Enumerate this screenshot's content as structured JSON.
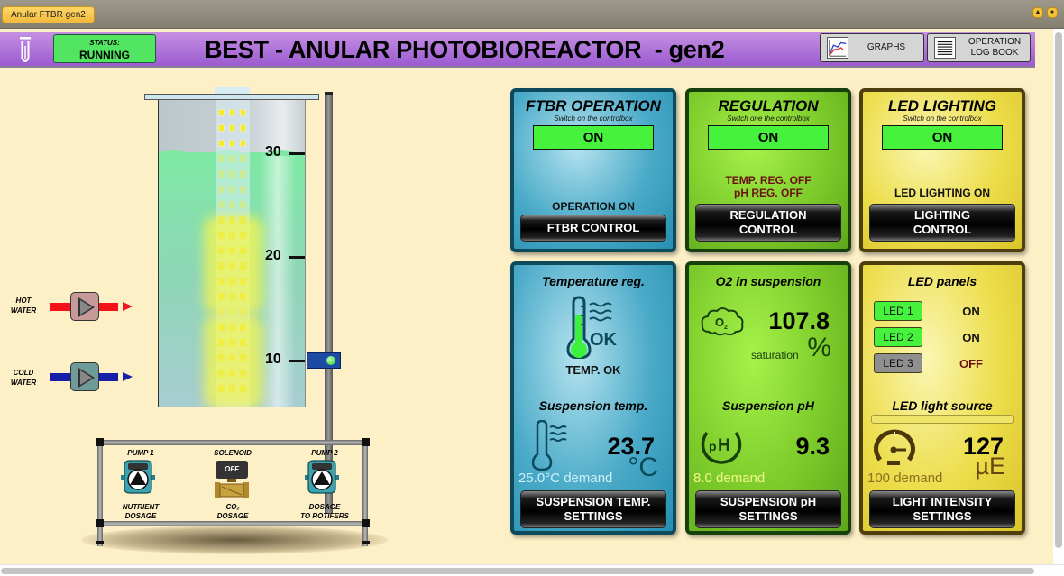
{
  "window": {
    "tab_title": "Anular FTBR gen2",
    "controls": [
      {
        "name": "minimize",
        "glyph": "▲"
      },
      {
        "name": "options",
        "glyph": "●"
      }
    ]
  },
  "header": {
    "logo_icon": "test-tube-icon",
    "status_label": "STATUS:",
    "status_value": "RUNNING",
    "title": "BEST - ANULAR PHOTOBIOREACTOR  - gen2",
    "buttons": [
      {
        "label": "GRAPHS",
        "icon": "graph-icon"
      },
      {
        "label": "OPERATION LOG BOOK",
        "icon": "log-book-icon"
      }
    ]
  },
  "reactor": {
    "scale_labels": [
      "30",
      "20",
      "10"
    ],
    "hot_water_label": "HOT WATER",
    "cold_water_label": "COLD WATER",
    "devices": {
      "pump1_title": "PUMP 1",
      "pump1_caption": "NUTRIENT DOSAGE",
      "solenoid_title": "SOLENOID",
      "solenoid_state": "OFF",
      "solenoid_caption_line1": "CO₂",
      "solenoid_caption_line2": "DOSAGE",
      "pump2_title": "PUMP 2",
      "pump2_caption_line1": "DOSAGE",
      "pump2_caption_line2": "TO ROTIFERS"
    },
    "level_sensor_active": true
  },
  "panels": {
    "ftbr": {
      "title": "FTBR OPERATION",
      "subtitle": "Switch on the controlbox",
      "switch_state": "ON",
      "status": "OPERATION ON",
      "button": "FTBR CONTROL",
      "color": "#4aaac8"
    },
    "regulation": {
      "title": "REGULATION",
      "subtitle": "Switch one the controlbox",
      "switch_state": "ON",
      "status_line1": "TEMP. REG. OFF",
      "status_line2": "pH REG. OFF",
      "button_line1": "REGULATION",
      "button_line2": "CONTROL",
      "color": "#7ccb2a"
    },
    "lighting": {
      "title": "LED LIGHTING",
      "subtitle": "Switch on the controlbox",
      "switch_state": "ON",
      "status": "LED LIGHTING ON",
      "button_line1": "LIGHTING",
      "button_line2": "CONTROL",
      "color": "#ecdd4a"
    },
    "temperature": {
      "reg_title": "Temperature reg.",
      "reg_icon_text": "OK",
      "reg_status": "TEMP. OK",
      "susp_title": "Suspension temp.",
      "value": "23.7",
      "unit": "°C",
      "demand": "25.0°C demand",
      "button_line1": "SUSPENSION TEMP.",
      "button_line2": "SETTINGS"
    },
    "o2_ph": {
      "o2_title": "O2 in suspension",
      "o2_value": "107.8",
      "o2_sub": "saturation",
      "o2_unit": "%",
      "ph_title": "Suspension pH",
      "ph_value": "9.3",
      "ph_demand": "8.0 demand",
      "button_line1": "SUSPENSION pH",
      "button_line2": "SETTINGS"
    },
    "led_panels": {
      "title": "LED panels",
      "leds": [
        {
          "label": "LED 1",
          "state": "ON",
          "active": true
        },
        {
          "label": "LED 2",
          "state": "ON",
          "active": true
        },
        {
          "label": "LED 3",
          "state": "OFF",
          "active": false
        }
      ],
      "source_title": "LED light source",
      "value": "127",
      "unit": "µE",
      "demand": "100 demand",
      "button_line1": "LIGHT INTENSITY",
      "button_line2": "SETTINGS"
    }
  }
}
